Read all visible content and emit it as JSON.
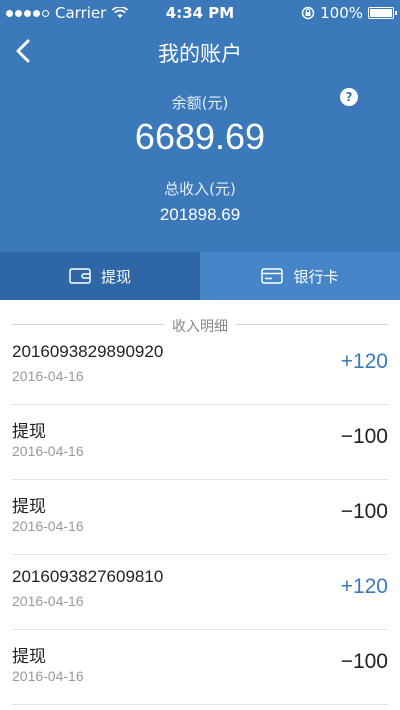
{
  "status_bar": {
    "carrier": "Carrier",
    "time": "4:34 PM",
    "battery": "100%"
  },
  "nav": {
    "title": "我的账户",
    "back_icon": "chevron-left-icon"
  },
  "account": {
    "balance_label": "余额(元)",
    "balance_value": "6689.69",
    "total_income_label": "总收入(元)",
    "total_income_value": "201898.69",
    "help_glyph": "?"
  },
  "tabs": [
    {
      "label": "提现",
      "icon": "wallet-icon"
    },
    {
      "label": "银行卡",
      "icon": "card-icon"
    }
  ],
  "section": {
    "title": "收入明细"
  },
  "transactions": [
    {
      "title": "2016093829890920",
      "date": "2016-04-16",
      "amount": "+120",
      "kind": "positive"
    },
    {
      "title": "提现",
      "date": "2016-04-16",
      "amount": "−100",
      "kind": "negative"
    },
    {
      "title": "提现",
      "date": "2016-04-16",
      "amount": "−100",
      "kind": "negative"
    },
    {
      "title": "2016093827609810",
      "date": "2016-04-16",
      "amount": "+120",
      "kind": "positive"
    },
    {
      "title": "提现",
      "date": "2016-04-16",
      "amount": "−100",
      "kind": "negative"
    }
  ],
  "colors": {
    "header_bg": "#3b79ba",
    "tab_withdraw_bg": "#2f66a6",
    "tab_bank_bg": "#4585c8",
    "positive_amount": "#3b79ba"
  }
}
